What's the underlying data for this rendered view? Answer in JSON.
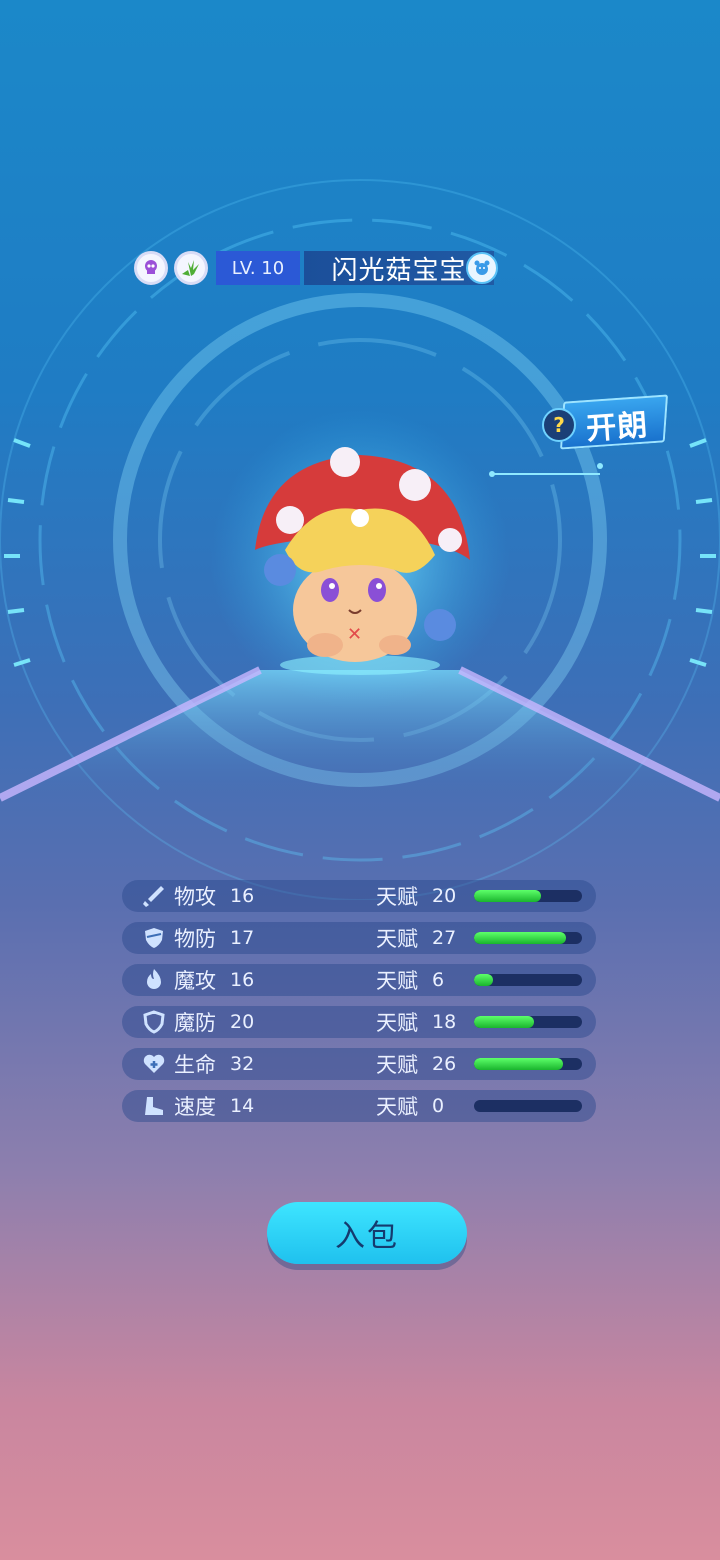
{
  "header": {
    "level_label": "LV. 10",
    "pet_name": "闪光菇宝宝",
    "badges": [
      "skull-badge-icon",
      "grass-badge-icon"
    ],
    "pet_type_icon": "pet-face-icon"
  },
  "trait": {
    "label": "开朗",
    "help_glyph": "?"
  },
  "stats": [
    {
      "icon": "sword-icon",
      "label": "物攻",
      "value": "16",
      "talent_label": "天赋",
      "talent_value": "20",
      "talent_fraction": 0.62
    },
    {
      "icon": "shield-icon",
      "label": "物防",
      "value": "17",
      "talent_label": "天赋",
      "talent_value": "27",
      "talent_fraction": 0.85
    },
    {
      "icon": "flame-icon",
      "label": "魔攻",
      "value": "16",
      "talent_label": "天赋",
      "talent_value": "6",
      "talent_fraction": 0.18
    },
    {
      "icon": "magic-shield-icon",
      "label": "魔防",
      "value": "20",
      "talent_label": "天赋",
      "talent_value": "18",
      "talent_fraction": 0.56
    },
    {
      "icon": "heart-plus-icon",
      "label": "生命",
      "value": "32",
      "talent_label": "天赋",
      "talent_value": "26",
      "talent_fraction": 0.82
    },
    {
      "icon": "boot-icon",
      "label": "速度",
      "value": "14",
      "talent_label": "天赋",
      "talent_value": "0",
      "talent_fraction": 0.0
    }
  ],
  "actions": {
    "bag_button": "入包"
  },
  "colors": {
    "accent": "#1fc1ee",
    "bar_fill": "#22c93a",
    "bar_track": "#1c2f63"
  }
}
